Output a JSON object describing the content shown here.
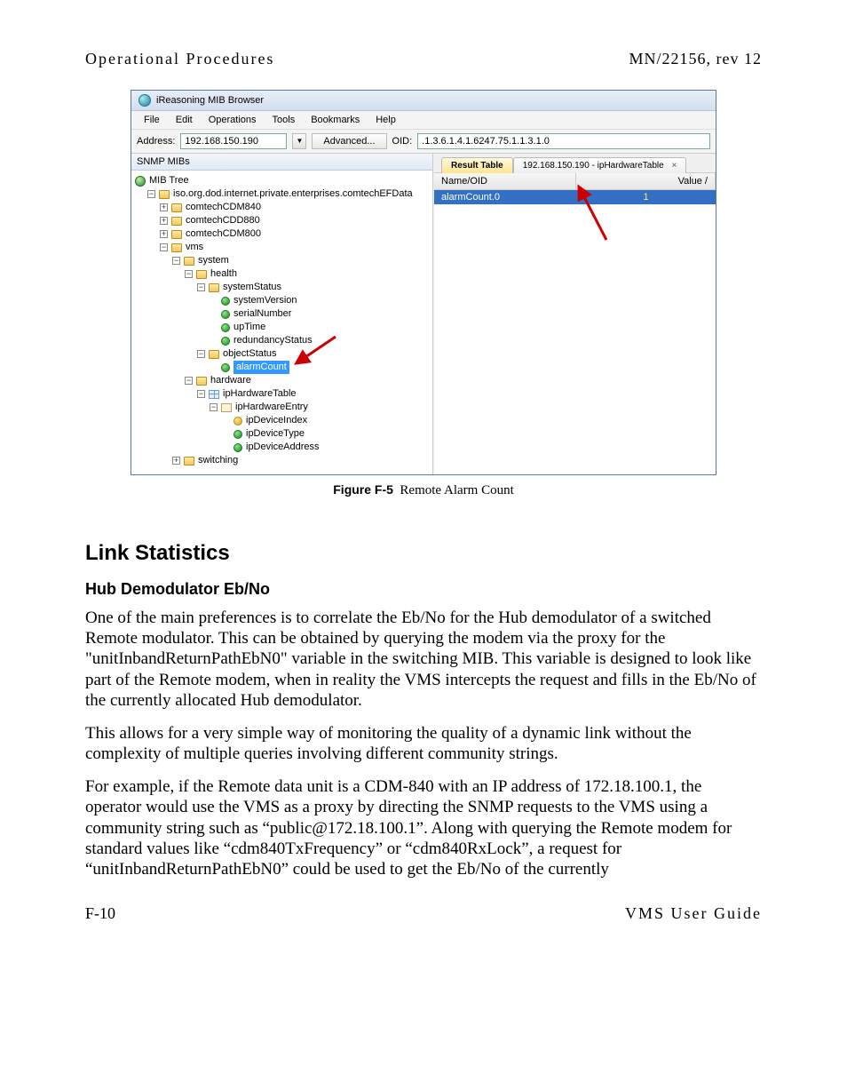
{
  "header": {
    "left": "Operational Procedures",
    "right": "MN/22156, rev 12"
  },
  "mib": {
    "title": "iReasoning MIB Browser",
    "menus": [
      "File",
      "Edit",
      "Operations",
      "Tools",
      "Bookmarks",
      "Help"
    ],
    "address_label": "Address:",
    "address_value": "192.168.150.190",
    "advanced_label": "Advanced...",
    "oid_label": "OID:",
    "oid_value": ".1.3.6.1.4.1.6247.75.1.1.3.1.0",
    "tree_header": "SNMP MIBs",
    "tree": {
      "root": "MIB Tree",
      "l1": "iso.org.dod.internet.private.enterprises.comtechEFData",
      "cdm840": "comtechCDM840",
      "cdd880": "comtechCDD880",
      "cdm800": "comtechCDM800",
      "vms": "vms",
      "system": "system",
      "health": "health",
      "systemStatus": "systemStatus",
      "systemVersion": "systemVersion",
      "serialNumber": "serialNumber",
      "upTime": "upTime",
      "redundancyStatus": "redundancyStatus",
      "objectStatus": "objectStatus",
      "alarmCount": "alarmCount",
      "hardware": "hardware",
      "ipHardwareTable": "ipHardwareTable",
      "ipHardwareEntry": "ipHardwareEntry",
      "ipDeviceIndex": "ipDeviceIndex",
      "ipDeviceType": "ipDeviceType",
      "ipDeviceAddress": "ipDeviceAddress",
      "switching": "switching"
    },
    "tabs": {
      "result": "Result Table",
      "hwtable": "192.168.150.190 - ipHardwareTable",
      "close": "×"
    },
    "grid": {
      "col_name": "Name/OID",
      "col_value": "Value /",
      "row_name": "alarmCount.0",
      "row_value": "1"
    }
  },
  "figure": {
    "label": "Figure F-5",
    "caption": "Remote Alarm Count"
  },
  "section": {
    "title": "Link Statistics"
  },
  "subsection": {
    "title": "Hub Demodulator Eb/No"
  },
  "paras": {
    "p1": "One of the main preferences is to correlate the Eb/No for the Hub demodulator of a switched Remote modulator. This can be obtained by querying the modem via the proxy for the \"unitInbandReturnPathEbN0\" variable in the switching MIB. This variable is designed to look like part of the Remote modem, when in reality the VMS intercepts the request and fills in the Eb/No of the currently allocated Hub demodulator.",
    "p2": "This allows for a very simple way of monitoring the quality of a dynamic link without the complexity of multiple queries involving different community strings.",
    "p3": "For example, if the Remote data unit is a CDM-840 with an IP address of 172.18.100.1, the operator would use the VMS as a proxy by directing the SNMP requests to the VMS using a community string such as “public@172.18.100.1”. Along with querying the Remote modem for standard values like “cdm840TxFrequency” or “cdm840RxLock”, a request for “unitInbandReturnPathEbN0” could be used to get the Eb/No of the currently"
  },
  "footer": {
    "left": "F-10",
    "right": "VMS User Guide"
  }
}
